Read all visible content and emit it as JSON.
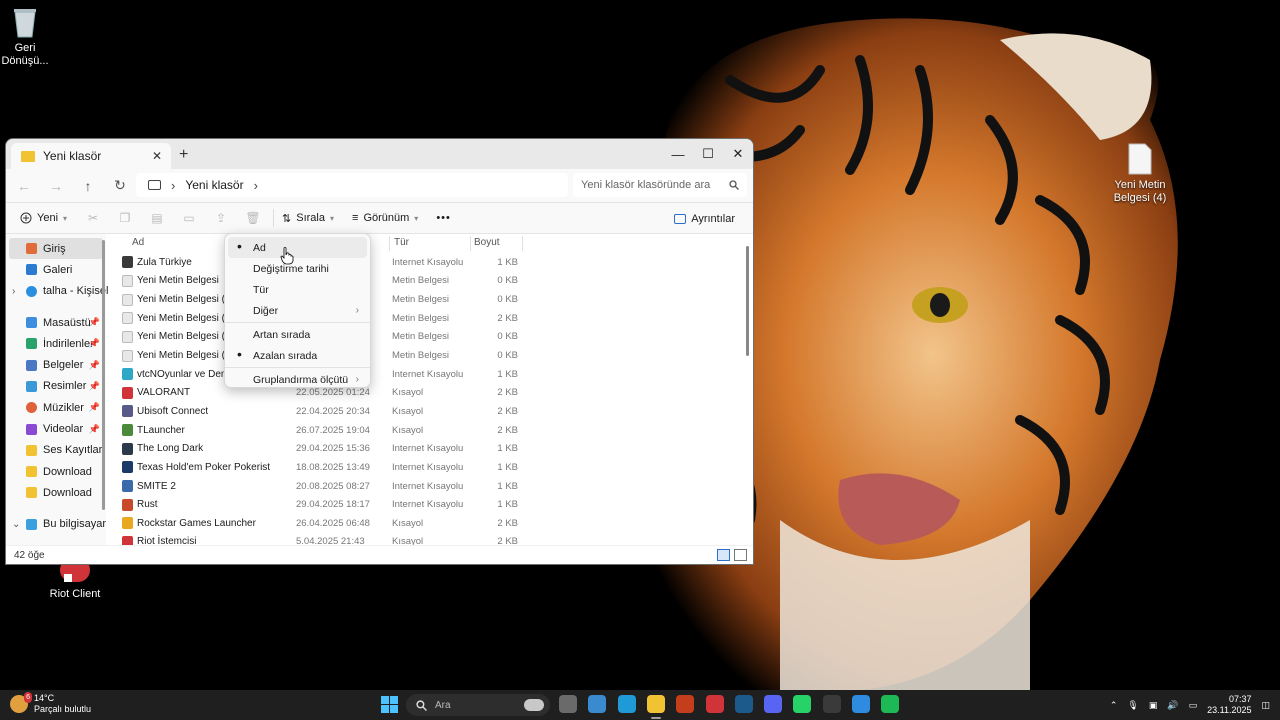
{
  "desktop": {
    "icons": [
      {
        "label": "Geri Dönüşü..."
      },
      {
        "label": "Yeni Metin Belgesi (4)"
      },
      {
        "label": "Riot Client"
      }
    ]
  },
  "window": {
    "tab_title": "Yeni klasör",
    "new_tab": "+",
    "controls": {
      "min": "—",
      "max": "☐",
      "close": "✕"
    }
  },
  "address": {
    "separator": "›",
    "crumb": "Yeni klasör",
    "search_placeholder": "Yeni klasör klasöründe ara"
  },
  "toolbar": {
    "new_label": "Yeni",
    "sort_label": "Sırala",
    "view_label": "Görünüm",
    "more_label": "•••",
    "details_label": "Ayrıntılar"
  },
  "nav": {
    "items": [
      {
        "label": "Giriş",
        "color": "#e06c3c"
      },
      {
        "label": "Galeri",
        "color": "#2b7bd1"
      },
      {
        "label": "talha - Kişisel",
        "color": "#2b8fe0"
      },
      {
        "label": "Masaüstü",
        "color": "#3e8ee0"
      },
      {
        "label": "İndirilenler",
        "color": "#2aa36b"
      },
      {
        "label": "Belgeler",
        "color": "#4a78c2"
      },
      {
        "label": "Resimler",
        "color": "#3a9ad9"
      },
      {
        "label": "Müzikler",
        "color": "#e0603c"
      },
      {
        "label": "Videolar",
        "color": "#8a4ad1"
      },
      {
        "label": "Ses Kayıtları",
        "color": "#f1c232"
      },
      {
        "label": "Download",
        "color": "#f1c232"
      },
      {
        "label": "Download",
        "color": "#f1c232"
      },
      {
        "label": "Bu bilgisayar",
        "color": "#3aa0e0"
      }
    ]
  },
  "columns": {
    "name": "Ad",
    "type": "Tür",
    "size": "Boyut"
  },
  "files": [
    {
      "name": "Zula Türkiye",
      "date": "",
      "type": "Internet Kısayolu",
      "size": "1 KB",
      "icon": "#3a3a3a"
    },
    {
      "name": "Yeni Metin Belgesi",
      "date": "",
      "type": "Metin Belgesi",
      "size": "0 KB",
      "icon": "#e8e8e8"
    },
    {
      "name": "Yeni Metin Belgesi (6)",
      "date": "",
      "type": "Metin Belgesi",
      "size": "0 KB",
      "icon": "#e8e8e8"
    },
    {
      "name": "Yeni Metin Belgesi (5)",
      "date": "",
      "type": "Metin Belgesi",
      "size": "2 KB",
      "icon": "#e8e8e8"
    },
    {
      "name": "Yeni Metin Belgesi (3)",
      "date": "",
      "type": "Metin Belgesi",
      "size": "0 KB",
      "icon": "#e8e8e8"
    },
    {
      "name": "Yeni Metin Belgesi (2)",
      "date": "",
      "type": "Metin Belgesi",
      "size": "0 KB",
      "icon": "#e8e8e8"
    },
    {
      "name": "vtcNOyunlar ve Demo S",
      "date": "",
      "type": "Internet Kısayolu",
      "size": "1 KB",
      "icon": "#2fa8c8"
    },
    {
      "name": "VALORANT",
      "date": "22.05.2025 01:24",
      "type": "Kısayol",
      "size": "2 KB",
      "icon": "#d13438"
    },
    {
      "name": "Ubisoft Connect",
      "date": "22.04.2025 20:34",
      "type": "Kısayol",
      "size": "2 KB",
      "icon": "#5a5a8a"
    },
    {
      "name": "TLauncher",
      "date": "26.07.2025 19:04",
      "type": "Kısayol",
      "size": "2 KB",
      "icon": "#4a8a3a"
    },
    {
      "name": "The Long Dark",
      "date": "29.04.2025 15:36",
      "type": "Internet Kısayolu",
      "size": "1 KB",
      "icon": "#2a3a4a"
    },
    {
      "name": "Texas Hold'em Poker Pokerist",
      "date": "18.08.2025 13:49",
      "type": "Internet Kısayolu",
      "size": "1 KB",
      "icon": "#1a3a6a"
    },
    {
      "name": "SMITE 2",
      "date": "20.08.2025 08:27",
      "type": "Internet Kısayolu",
      "size": "1 KB",
      "icon": "#3a6aaa"
    },
    {
      "name": "Rust",
      "date": "29.04.2025 18:17",
      "type": "Internet Kısayolu",
      "size": "1 KB",
      "icon": "#c84a2a"
    },
    {
      "name": "Rockstar Games Launcher",
      "date": "26.04.2025 06:48",
      "type": "Kısayol",
      "size": "2 KB",
      "icon": "#e8a820"
    },
    {
      "name": "Riot İstemcisi",
      "date": "5.04.2025 21:43",
      "type": "Kısayol",
      "size": "2 KB",
      "icon": "#d13438"
    }
  ],
  "status": {
    "count": "42 öğe"
  },
  "context_menu": {
    "items": [
      {
        "label": "Ad",
        "checked": true
      },
      {
        "label": "Değiştirme tarihi",
        "checked": false
      },
      {
        "label": "Tür",
        "checked": false
      },
      {
        "label": "Diğer",
        "checked": false,
        "submenu": true
      },
      {
        "label": "Artan sırada",
        "checked": false
      },
      {
        "label": "Azalan sırada",
        "checked": true
      },
      {
        "label": "Gruplandırma ölçütü",
        "checked": false,
        "submenu": true
      }
    ],
    "bullet": "•",
    "submenu_arrow": "›"
  },
  "taskbar": {
    "weather_temp": "14°C",
    "weather_desc": "Parçalı bulutlu",
    "weather_badge": "6",
    "search_placeholder": "Ara",
    "time": "07:37",
    "date": "23.11.2025",
    "apps": [
      {
        "name": "taskview-icon",
        "color": "#6a6a6a"
      },
      {
        "name": "widgets-icon",
        "color": "#3a8ad0"
      },
      {
        "name": "edge-icon",
        "color": "#1f9ad6"
      },
      {
        "name": "explorer-icon",
        "color": "#f1c232"
      },
      {
        "name": "office-icon",
        "color": "#c43e1c"
      },
      {
        "name": "riot-icon",
        "color": "#d13438"
      },
      {
        "name": "steam-icon",
        "color": "#1b5a8a"
      },
      {
        "name": "discord-icon",
        "color": "#5865f2"
      },
      {
        "name": "whatsapp-icon",
        "color": "#25d366"
      },
      {
        "name": "chatgpt-icon",
        "color": "#3a3a3a"
      },
      {
        "name": "photos-icon",
        "color": "#2f8be0"
      },
      {
        "name": "spotify-icon",
        "color": "#1db954"
      }
    ]
  }
}
